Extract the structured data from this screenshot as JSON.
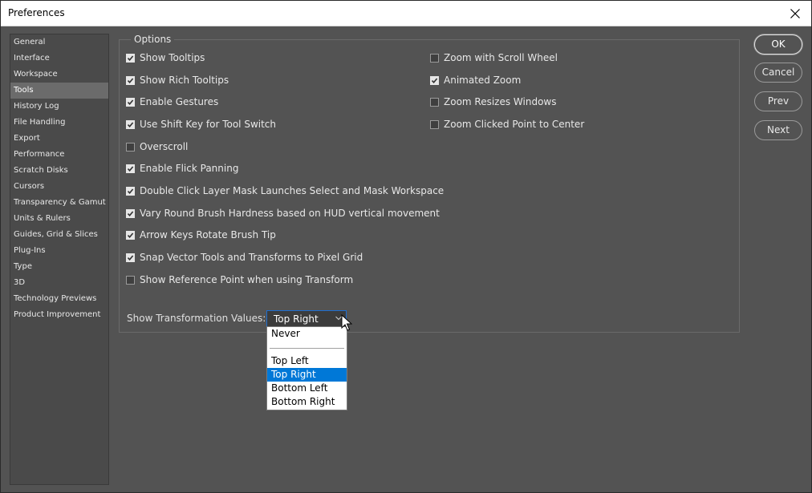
{
  "window": {
    "title": "Preferences"
  },
  "sidebar": {
    "items": [
      {
        "label": "General"
      },
      {
        "label": "Interface"
      },
      {
        "label": "Workspace"
      },
      {
        "label": "Tools"
      },
      {
        "label": "History Log"
      },
      {
        "label": "File Handling"
      },
      {
        "label": "Export"
      },
      {
        "label": "Performance"
      },
      {
        "label": "Scratch Disks"
      },
      {
        "label": "Cursors"
      },
      {
        "label": "Transparency & Gamut"
      },
      {
        "label": "Units & Rulers"
      },
      {
        "label": "Guides, Grid & Slices"
      },
      {
        "label": "Plug-Ins"
      },
      {
        "label": "Type"
      },
      {
        "label": "3D"
      },
      {
        "label": "Technology Previews"
      },
      {
        "label": "Product Improvement"
      }
    ],
    "active": "Tools"
  },
  "options": {
    "legend": "Options",
    "left": [
      {
        "label": "Show Tooltips",
        "checked": true
      },
      {
        "label": "Show Rich Tooltips",
        "checked": true
      },
      {
        "label": "Enable Gestures",
        "checked": true
      },
      {
        "label": "Use Shift Key for Tool Switch",
        "checked": true
      },
      {
        "label": "Overscroll",
        "checked": false
      },
      {
        "label": "Enable Flick Panning",
        "checked": true
      },
      {
        "label": "Double Click Layer Mask Launches Select and Mask Workspace",
        "checked": true
      },
      {
        "label": "Vary Round Brush Hardness based on HUD vertical movement",
        "checked": true
      },
      {
        "label": "Arrow Keys Rotate Brush Tip",
        "checked": true
      },
      {
        "label": "Snap Vector Tools and Transforms to Pixel Grid",
        "checked": true
      },
      {
        "label": "Show Reference Point when using Transform",
        "checked": false
      }
    ],
    "right": [
      {
        "label": "Zoom with Scroll Wheel",
        "checked": false
      },
      {
        "label": "Animated Zoom",
        "checked": true
      },
      {
        "label": "Zoom Resizes Windows",
        "checked": false
      },
      {
        "label": "Zoom Clicked Point to Center",
        "checked": false
      }
    ]
  },
  "transform_values": {
    "label": "Show Transformation Values:",
    "selected": "Top Right",
    "options": [
      "Never",
      "Top Left",
      "Top Right",
      "Bottom Left",
      "Bottom Right"
    ]
  },
  "buttons": {
    "ok": "OK",
    "cancel": "Cancel",
    "prev": "Prev",
    "next": "Next"
  },
  "colors": {
    "panel_bg": "#535353",
    "sidebar_bg": "#4a4a4a",
    "active_item": "#6b6b6b",
    "selection_blue": "#0078d7"
  }
}
